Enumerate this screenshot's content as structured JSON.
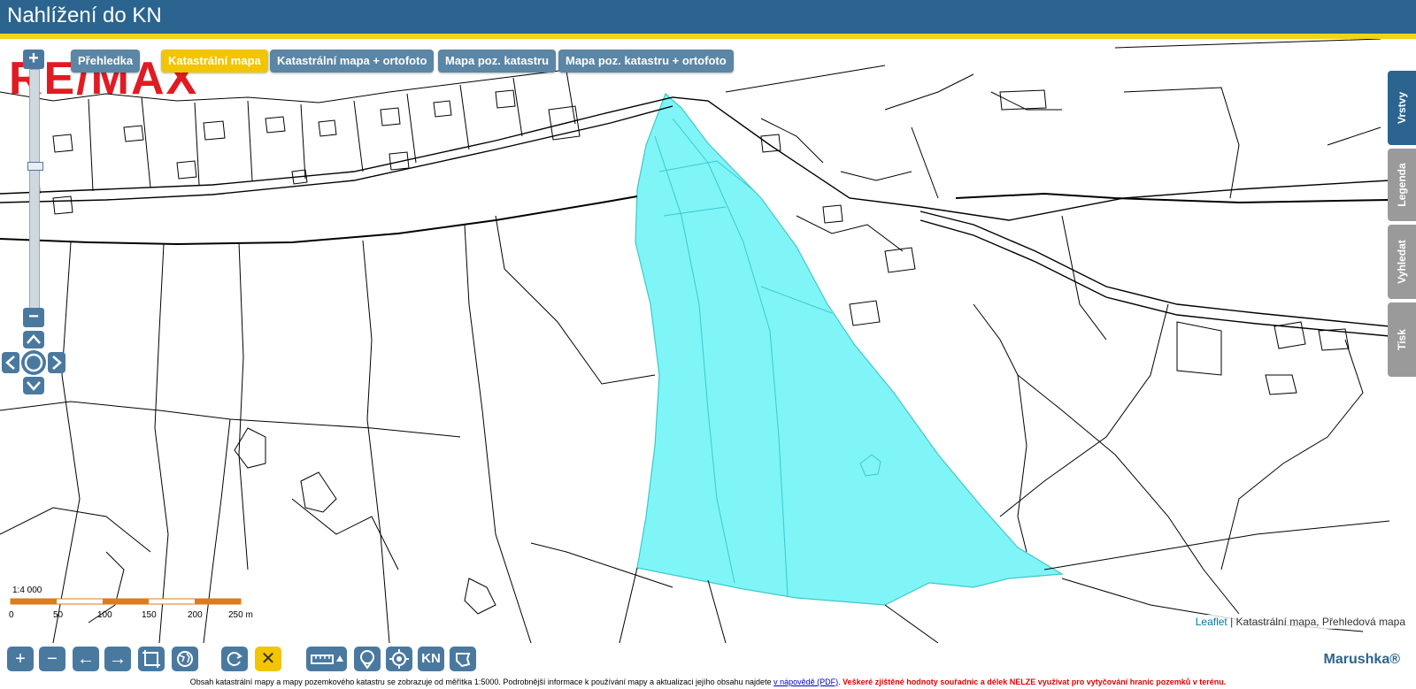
{
  "app": {
    "title": "Nahlížení do KN"
  },
  "tabs": [
    {
      "label": "Přehledka",
      "active": false
    },
    {
      "label": "Katastrální mapa",
      "active": true
    },
    {
      "label": "Katastrální mapa + ortofoto",
      "active": false
    },
    {
      "label": "Mapa poz. katastru",
      "active": false
    },
    {
      "label": "Mapa poz. katastru + ortofoto",
      "active": false
    }
  ],
  "logo": {
    "text": "RE/MAX",
    "color": "#e11b22"
  },
  "zoom": {
    "in_label": "+",
    "out_label": "−"
  },
  "side_tabs": [
    {
      "label": "Vrstvy",
      "active": true
    },
    {
      "label": "Legenda",
      "active": false
    },
    {
      "label": "Vyhledat",
      "active": false
    },
    {
      "label": "Tisk",
      "active": false
    }
  ],
  "scale": {
    "ratio": "1:4 000",
    "ticks": [
      "0",
      "50",
      "100",
      "150",
      "200",
      "250 m"
    ]
  },
  "attribution": {
    "link": "Leaflet",
    "text": " | Katastrální mapa, Přehledová mapa"
  },
  "toolbar": {
    "buttons": [
      {
        "name": "zoom-in-button",
        "icon": "plus-icon"
      },
      {
        "name": "zoom-out-button",
        "icon": "minus-icon"
      },
      {
        "name": "back-button",
        "icon": "arrow-left-icon"
      },
      {
        "name": "forward-button",
        "icon": "arrow-right-icon"
      },
      {
        "name": "zoom-box-button",
        "icon": "crop-icon"
      },
      {
        "name": "full-extent-button",
        "icon": "globe-icon"
      },
      {
        "name": "refresh-button",
        "icon": "refresh-icon"
      },
      {
        "name": "clear-button",
        "icon": "close-icon"
      },
      {
        "name": "measure-button",
        "icon": "ruler-icon"
      },
      {
        "name": "marker-button",
        "icon": "pin-icon"
      },
      {
        "name": "locate-button",
        "icon": "target-icon"
      },
      {
        "name": "kn-button",
        "icon": "kn-icon",
        "label": "KN"
      },
      {
        "name": "select-button",
        "icon": "pointer-icon"
      }
    ],
    "brand": "Marushka®"
  },
  "footer": {
    "text": "Obsah katastrální mapy a mapy pozemkového katastru se zobrazuje od měřítka 1:5000. Podrobnější informace k používání mapy a aktualizaci jejího obsahu najdete",
    "link": "v nápovědě (PDF)",
    "warning": "Veškeré zjištěné hodnoty souřadnic a délek NELZE využívat pro vytyčování hranic pozemků v terénu."
  },
  "colors": {
    "header": "#2a648f",
    "stripe": "#f2d31b",
    "highlight": "#7ff5f7",
    "button": "#4a79a0"
  }
}
